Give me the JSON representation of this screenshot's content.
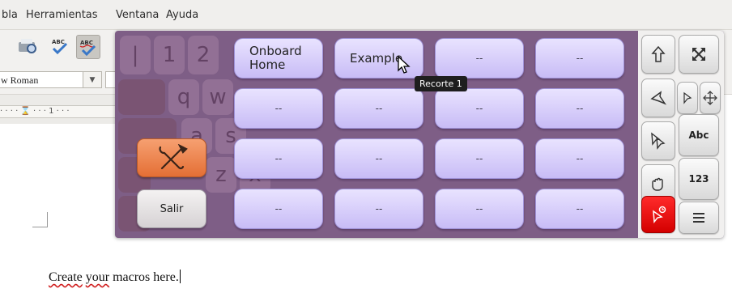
{
  "menubar": {
    "items": [
      "bla",
      "Herramientas",
      "Ventana",
      "Ayuda"
    ]
  },
  "toolbar": {
    "font_name": "w Roman",
    "font_dropdown_arrow": "▼"
  },
  "ruler": {
    "text": "· · · · ⌛ · · · 1 · · ·"
  },
  "document": {
    "word1": "Create",
    "word2": "your",
    "rest": "macros here."
  },
  "onboard": {
    "snippets": [
      {
        "label": "Onboard Home"
      },
      {
        "label": "Example"
      },
      {
        "label": "--"
      },
      {
        "label": "--"
      },
      {
        "label": "--"
      },
      {
        "label": "--"
      },
      {
        "label": "--"
      },
      {
        "label": "--"
      },
      {
        "label": "--"
      },
      {
        "label": "--"
      },
      {
        "label": "--"
      },
      {
        "label": "--"
      },
      {
        "label": "--"
      },
      {
        "label": "--"
      },
      {
        "label": "--"
      },
      {
        "label": "--"
      }
    ],
    "quit_label": "Salir",
    "tooltip": "Recorte 1",
    "side_panel": {
      "abc_label": "Abc",
      "num_label": "123"
    },
    "ghost_keys": [
      "|",
      "1",
      "2",
      "q",
      "w",
      "a",
      "s",
      "z",
      "x"
    ]
  },
  "colors": {
    "keyboard_bg": "#7e5e86",
    "snippet_key": "#d9d1fb",
    "settings_key": "#e97a3f",
    "red_key": "#e00000"
  }
}
